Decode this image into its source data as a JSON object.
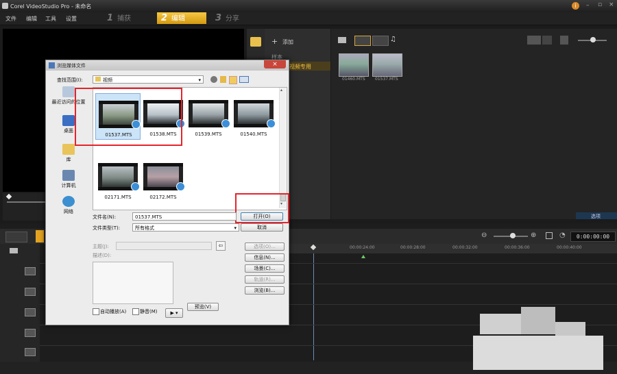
{
  "app": {
    "title": "Corel VideoStudio Pro - 未命名"
  },
  "menu": [
    "文件",
    "编辑",
    "工具",
    "设置"
  ],
  "steps": [
    {
      "num": "1",
      "label": "捕获"
    },
    {
      "num": "2",
      "label": "编辑"
    },
    {
      "num": "3",
      "label": "分享"
    }
  ],
  "library": {
    "add_label": "添加",
    "nav_items": [
      "样本",
      "视频专用"
    ],
    "clips": [
      "01460.MTS",
      "01537.MTS"
    ],
    "options_label": "选项"
  },
  "timeline": {
    "timecode": "0:00:00:00",
    "ruler_ticks": [
      "00:00:24:00",
      "00:00:28:00",
      "00:00:32:00",
      "00:00:36:00",
      "00:00:40:00"
    ]
  },
  "dialog": {
    "title": "浏览媒体文件",
    "lookin_label": "查找范围(I):",
    "lookin_value": "视频",
    "places": [
      "最近访问的位置",
      "桌面",
      "库",
      "计算机",
      "网络"
    ],
    "files": [
      "01537.MTS",
      "01538.MTS",
      "01539.MTS",
      "01540.MTS",
      "02171.MTS",
      "02172.MTS"
    ],
    "filename_label": "文件名(N):",
    "filename_value": "01537.MTS",
    "filetype_label": "文件类型(T):",
    "filetype_value": "所有格式",
    "open_label": "打开(O)",
    "cancel_label": "取消",
    "subject_label": "主题(J):",
    "desc_label": "描述(D):",
    "side_buttons": [
      "选项(O)...",
      "信息(N)...",
      "场景(C)...",
      "轨道(R)...",
      "浏览(B)..."
    ],
    "autoplay_label": "自动播放(A)",
    "mute_label": "静音(M)",
    "preview_label": "预览(V)"
  },
  "colors": {
    "accent": "#e4a421",
    "highlight_box": "#e4232b"
  }
}
